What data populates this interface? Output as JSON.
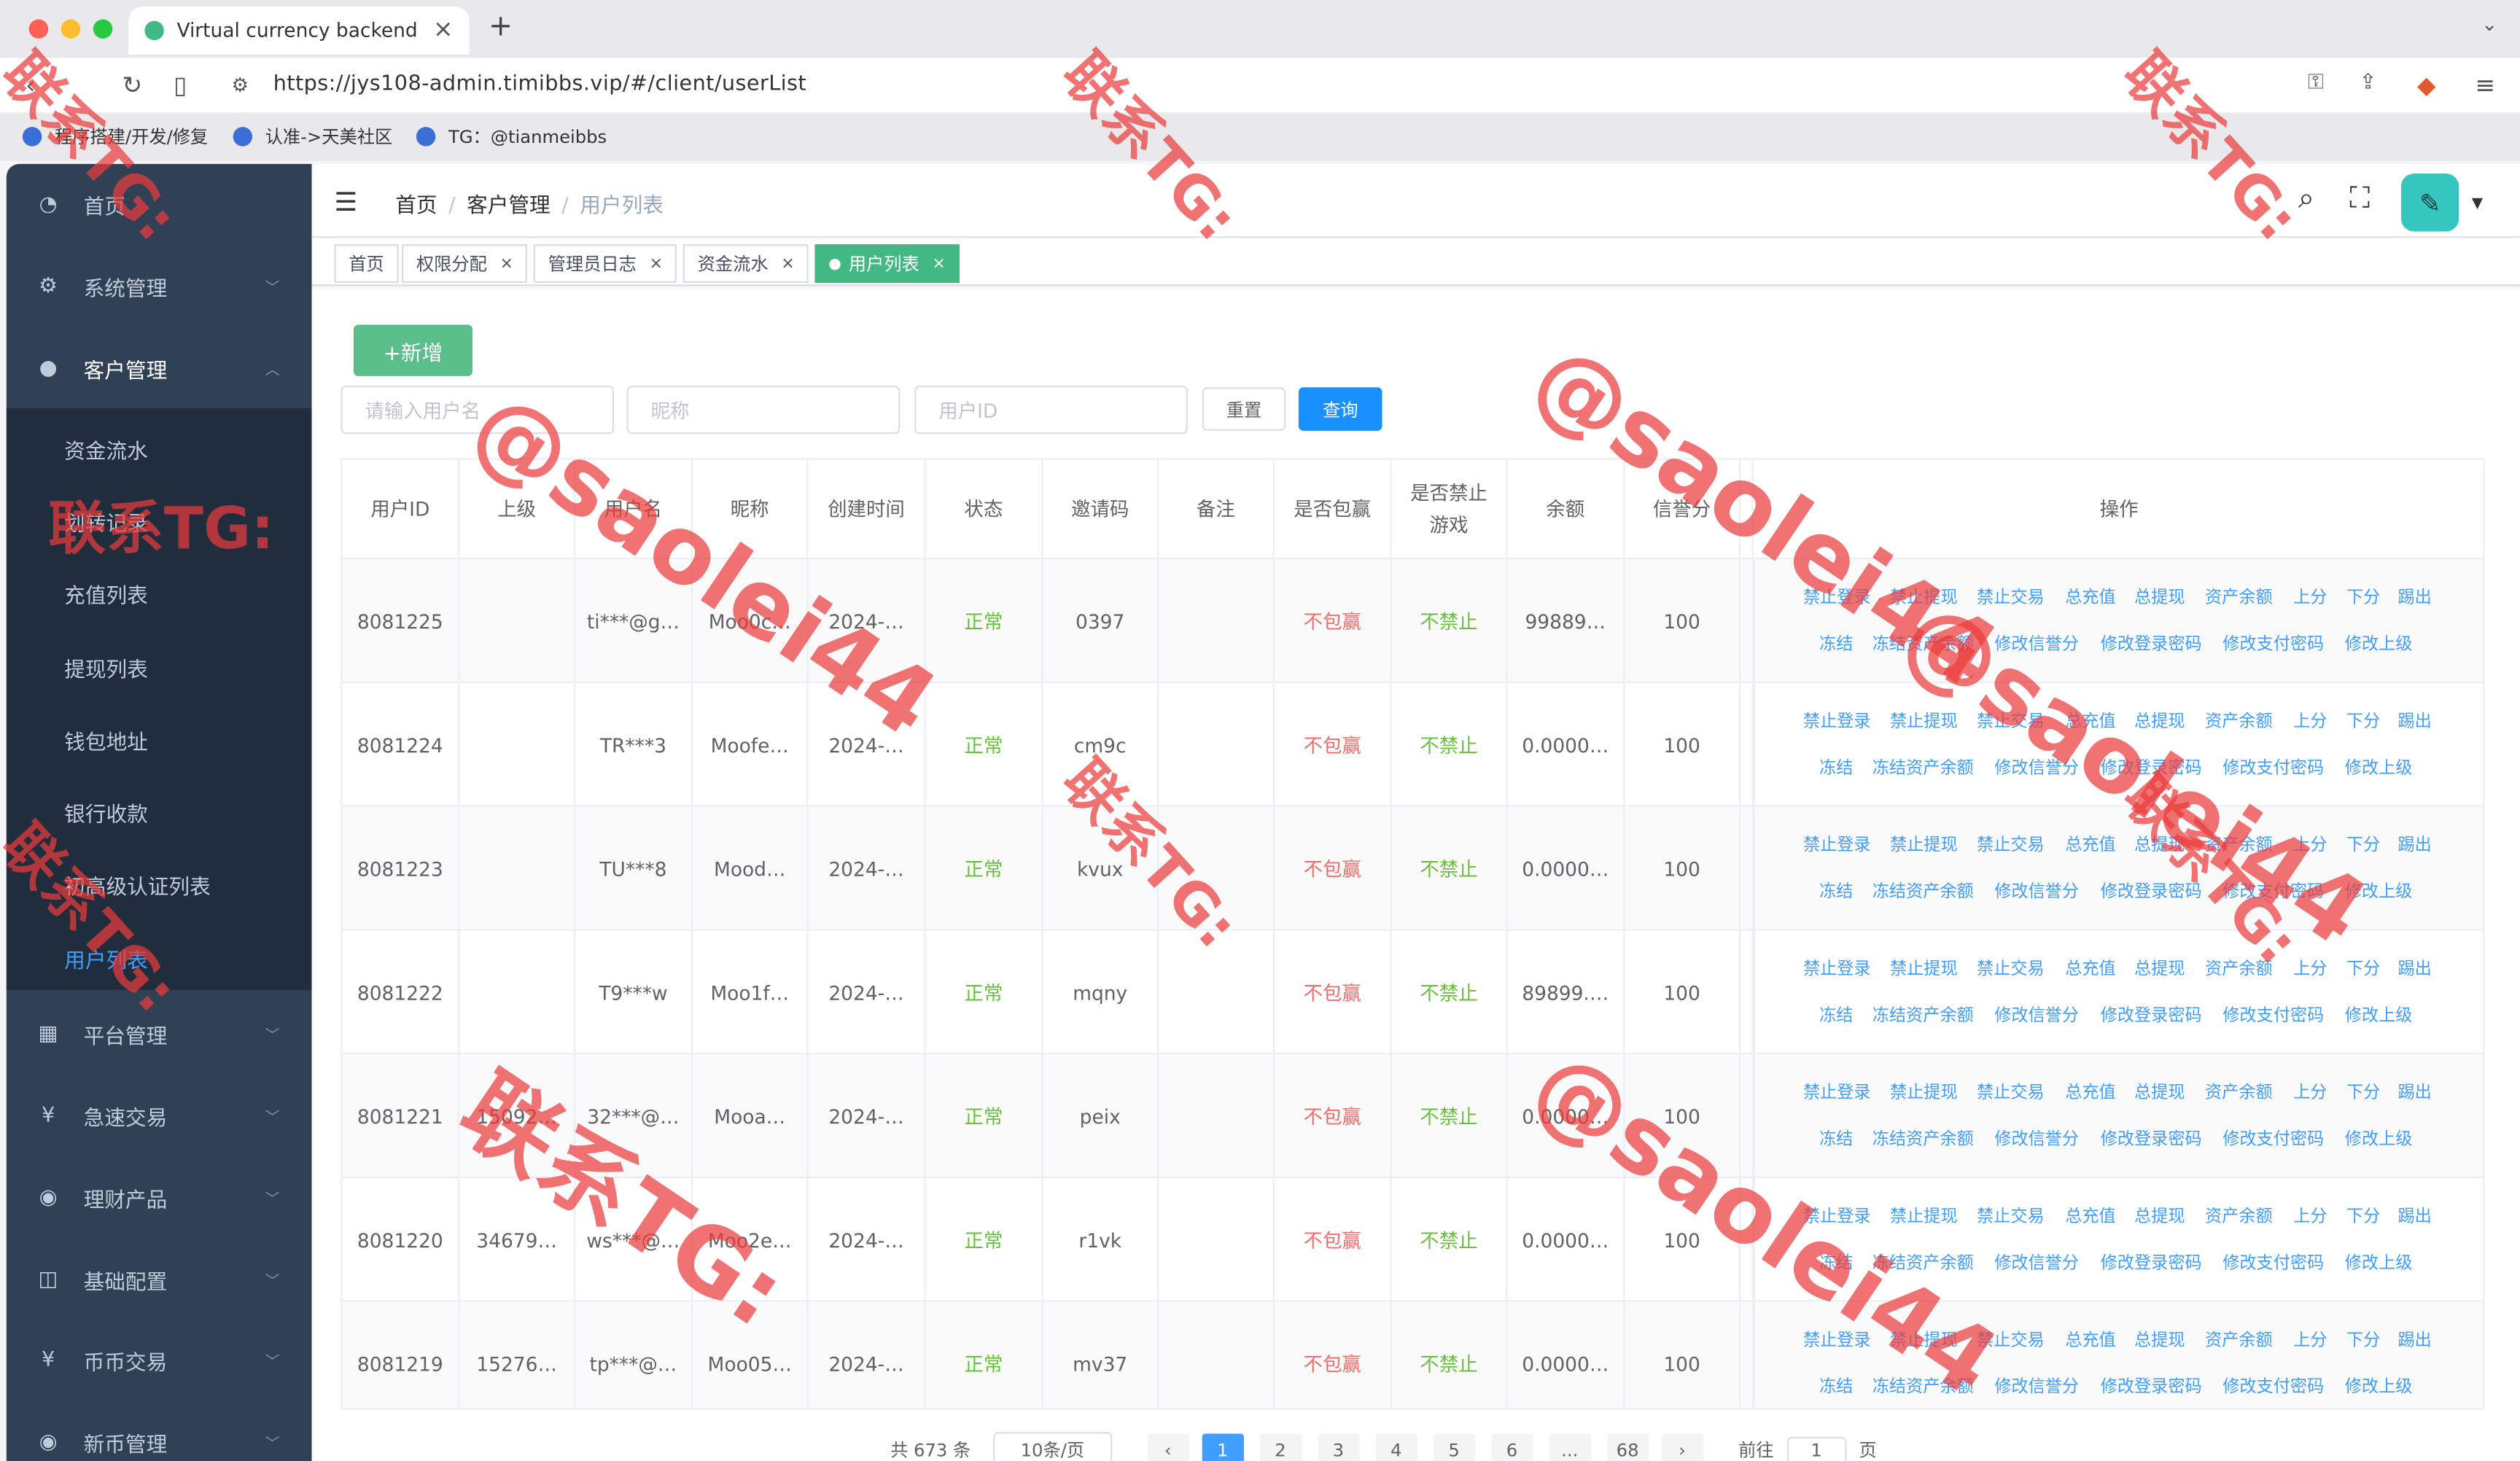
{
  "browser": {
    "tab_title": "Virtual currency backend",
    "url": "https://jys108-admin.timibbs.vip/#/client/userList",
    "bookmarks": [
      "程序搭建/开发/修复",
      "认准->天美社区",
      "TG：@tianmeibbs"
    ]
  },
  "sidebar": {
    "items": [
      {
        "label": "首页",
        "icon": "dashboard-icon"
      },
      {
        "label": "系统管理",
        "icon": "gear-icon"
      },
      {
        "label": "客户管理",
        "icon": "user-icon"
      },
      {
        "label": "平台管理",
        "icon": "grid-icon"
      },
      {
        "label": "急速交易",
        "icon": "yen-icon"
      },
      {
        "label": "理财产品",
        "icon": "circle-icon"
      },
      {
        "label": "基础配置",
        "icon": "book-icon"
      },
      {
        "label": "币币交易",
        "icon": "yen-icon"
      },
      {
        "label": "新币管理",
        "icon": "circle-icon"
      }
    ],
    "submenu": [
      "资金流水",
      "划转记录",
      "充值列表",
      "提现列表",
      "钱包地址",
      "银行收款",
      "初高级认证列表",
      "用户列表"
    ]
  },
  "breadcrumb": [
    "首页",
    "客户管理",
    "用户列表"
  ],
  "tags": [
    "首页",
    "权限分配",
    "管理员日志",
    "资金流水",
    "用户列表"
  ],
  "toolbar": {
    "add_label": "+新增",
    "username_placeholder": "请输入用户名",
    "nickname_placeholder": "昵称",
    "userid_placeholder": "用户ID",
    "reset_label": "重置",
    "query_label": "查询"
  },
  "table": {
    "headers": [
      "用户ID",
      "上级",
      "用户名",
      "昵称",
      "创建时间",
      "状态",
      "邀请码",
      "备注",
      "是否包赢",
      "是否禁止游戏",
      "余额",
      "信誉分",
      "操作"
    ],
    "rows": [
      {
        "id": "8081225",
        "parent": "",
        "username": "ti***@g…",
        "nickname": "Moo0c…",
        "created": "2024-…",
        "status": "正常",
        "invite": "0397",
        "remark": "",
        "win": "不包赢",
        "ban": "不禁止",
        "balance": "99889…",
        "credit": "100"
      },
      {
        "id": "8081224",
        "parent": "",
        "username": "TR***3",
        "nickname": "Moofe…",
        "created": "2024-…",
        "status": "正常",
        "invite": "cm9c",
        "remark": "",
        "win": "不包赢",
        "ban": "不禁止",
        "balance": "0.0000…",
        "credit": "100"
      },
      {
        "id": "8081223",
        "parent": "",
        "username": "TU***8",
        "nickname": "Mood…",
        "created": "2024-…",
        "status": "正常",
        "invite": "kvux",
        "remark": "",
        "win": "不包赢",
        "ban": "不禁止",
        "balance": "0.0000…",
        "credit": "100"
      },
      {
        "id": "8081222",
        "parent": "",
        "username": "T9***w",
        "nickname": "Moo1f…",
        "created": "2024-…",
        "status": "正常",
        "invite": "mqny",
        "remark": "",
        "win": "不包赢",
        "ban": "不禁止",
        "balance": "89899.…",
        "credit": "100"
      },
      {
        "id": "8081221",
        "parent": "15092…",
        "username": "32***@…",
        "nickname": "Mooa…",
        "created": "2024-…",
        "status": "正常",
        "invite": "peix",
        "remark": "",
        "win": "不包赢",
        "ban": "不禁止",
        "balance": "0.0000…",
        "credit": "100"
      },
      {
        "id": "8081220",
        "parent": "34679…",
        "username": "ws***@…",
        "nickname": "Moo2e…",
        "created": "2024-…",
        "status": "正常",
        "invite": "r1vk",
        "remark": "",
        "win": "不包赢",
        "ban": "不禁止",
        "balance": "0.0000…",
        "credit": "100"
      },
      {
        "id": "8081219",
        "parent": "15276…",
        "username": "tp***@…",
        "nickname": "Moo05…",
        "created": "2024-…",
        "status": "正常",
        "invite": "mv37",
        "remark": "",
        "win": "不包赢",
        "ban": "不禁止",
        "balance": "0.0000…",
        "credit": "100"
      }
    ],
    "actions_line1": [
      "禁止登录",
      "禁止提现",
      "禁止交易",
      "总充值",
      "总提现",
      "资产余额",
      "上分",
      "下分",
      "踢出"
    ],
    "actions_line2": [
      "冻结",
      "冻结资产余额",
      "修改信誉分",
      "修改登录密码",
      "修改支付密码",
      "修改上级"
    ]
  },
  "pagination": {
    "total": "共 673 条",
    "page_size": "10条/页",
    "pages": [
      "1",
      "2",
      "3",
      "4",
      "5",
      "6",
      "...",
      "68"
    ],
    "goto_label": "前往",
    "goto_value": "1",
    "page_unit": "页"
  },
  "watermarks": [
    "联系TG:",
    "@saolei44",
    "联系TG:",
    "@saolei44",
    "联系TG:",
    "@saolei44",
    "联系TG:",
    "@saolei44",
    "联系TG:",
    "联系TG:",
    "联系TG:",
    "联系TG:"
  ]
}
